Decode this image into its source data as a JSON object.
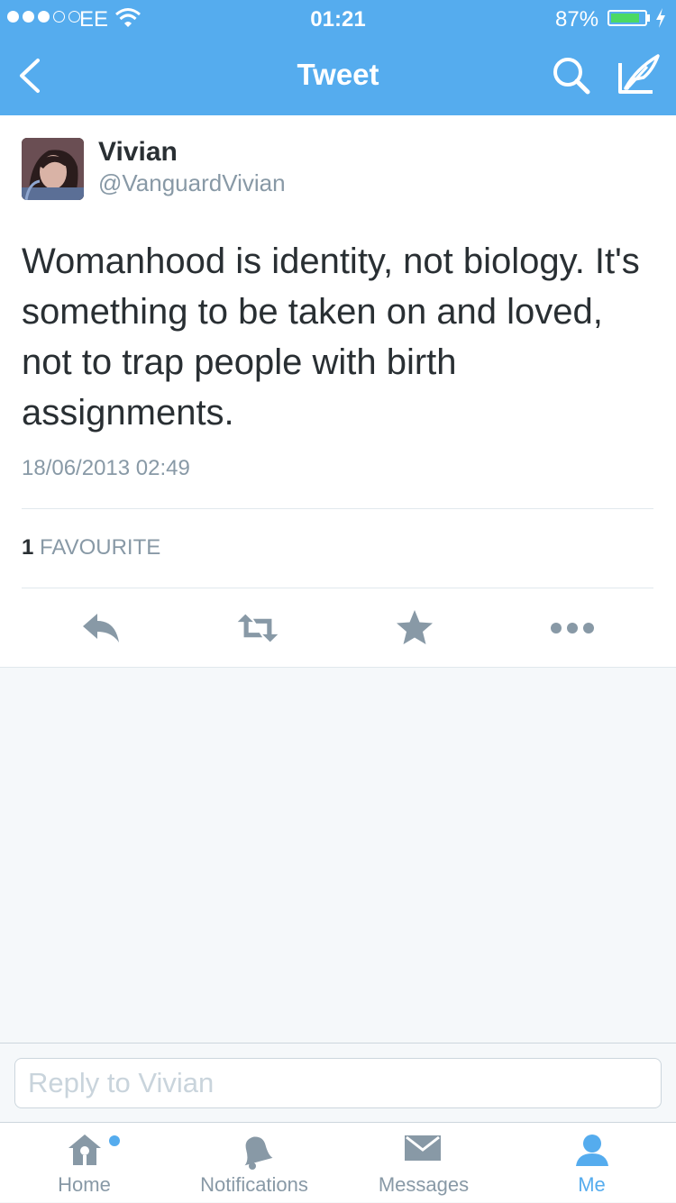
{
  "status_bar": {
    "carrier": "EE",
    "time": "01:21",
    "battery_percent": "87%",
    "battery_level": 0.87,
    "signal_bars": 3
  },
  "nav": {
    "title": "Tweet",
    "back_icon": "chevron-left-icon",
    "search_icon": "search-icon",
    "compose_icon": "compose-quill-icon",
    "color": "#55acee"
  },
  "tweet": {
    "name": "Vivian",
    "handle": "@VanguardVivian",
    "text": "Womanhood is identity, not biology. It's something to be taken on and loved, not to trap people with birth assignments.",
    "timestamp": "18/06/2013 02:49",
    "favourite_count": "1",
    "favourite_label": "FAVOURITE"
  },
  "actions": [
    "reply-icon",
    "retweet-icon",
    "star-icon",
    "more-icon"
  ],
  "reply": {
    "placeholder": "Reply to Vivian"
  },
  "tabs": [
    {
      "label": "Home",
      "icon": "home-icon",
      "has_dot": true
    },
    {
      "label": "Notifications",
      "icon": "bell-icon",
      "has_dot": false
    },
    {
      "label": "Messages",
      "icon": "envelope-icon",
      "has_dot": false
    },
    {
      "label": "Me",
      "icon": "person-icon",
      "active": true
    }
  ],
  "colors": {
    "accent": "#55acee",
    "text": "#292f33",
    "secondary": "#8899a6",
    "icon_gray": "#8899a6",
    "battery_green": "#4cd964"
  }
}
